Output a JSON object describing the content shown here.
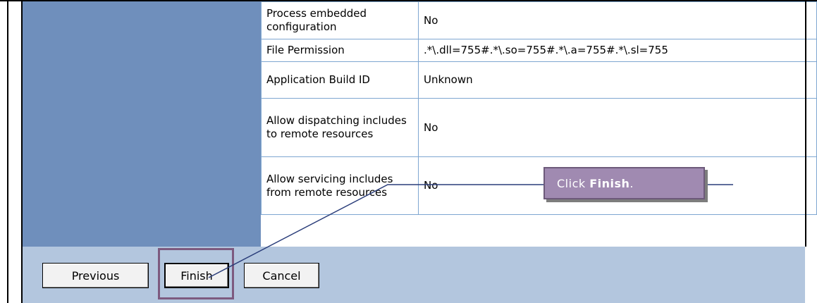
{
  "properties": [
    {
      "label": "Process embedded configuration",
      "value": "No"
    },
    {
      "label": "File Permission",
      "value": ".*\\.dll=755#.*\\.so=755#.*\\.a=755#.*\\.sl=755"
    },
    {
      "label": "Application Build ID",
      "value": "Unknown"
    },
    {
      "label": "Allow dispatching includes to remote resources",
      "value": "No"
    },
    {
      "label": "Allow servicing includes from remote resources",
      "value": "No"
    }
  ],
  "buttons": {
    "previous": "Previous",
    "finish": "Finish",
    "cancel": "Cancel"
  },
  "callout": {
    "prefix": "Click ",
    "emphasis": "Finish",
    "suffix": "."
  },
  "colors": {
    "panel_blue": "#6f8fbc",
    "footer_blue": "#b3c6de",
    "callout_purple": "#a08ab1",
    "highlight_border": "#7d5a7f",
    "table_border": "#7ea6d1"
  }
}
